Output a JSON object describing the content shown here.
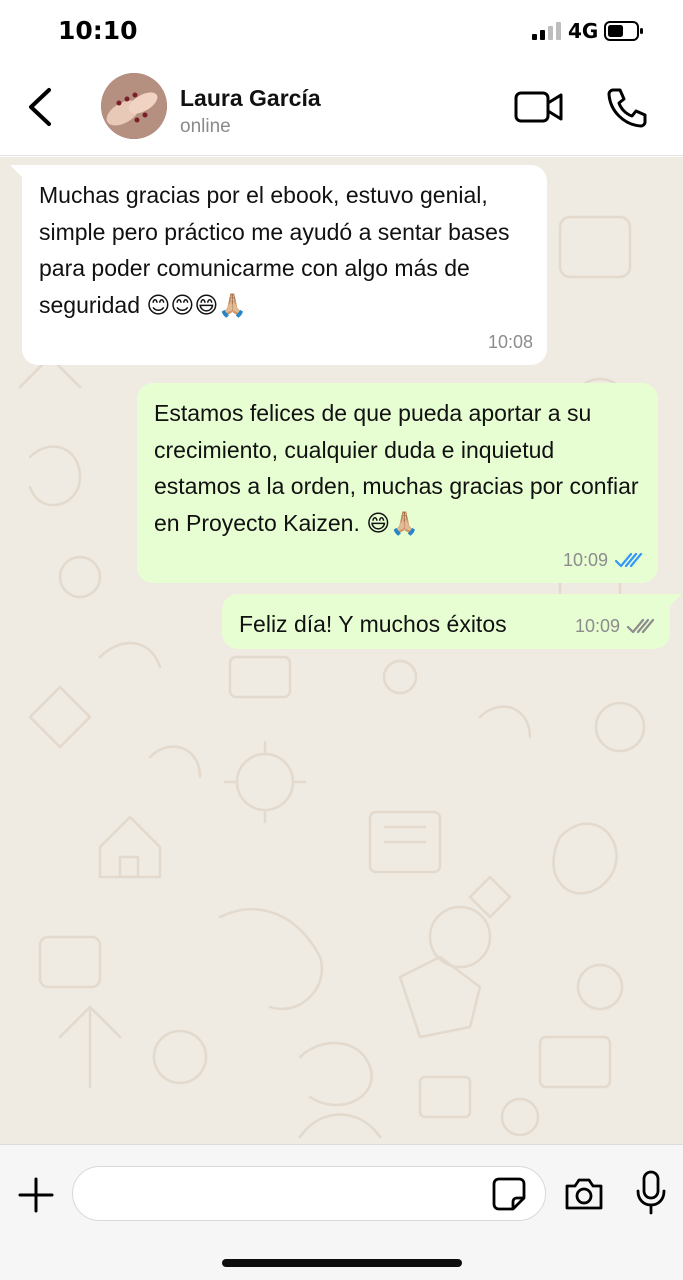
{
  "status_bar": {
    "time": "10:10",
    "network": "4G"
  },
  "header": {
    "contact_name": "Laura García",
    "contact_status": "online"
  },
  "messages": [
    {
      "direction": "incoming",
      "text": "Muchas gracias por el ebook, estuvo genial, simple pero práctico me ayudó a sentar bases para poder comunicarme con algo más de seguridad 😊😊😄🙏🏼",
      "time": "10:08"
    },
    {
      "direction": "outgoing",
      "text": "Estamos felices de que pueda aportar a su crecimiento, cualquier duda e inquietud estamos a la orden, muchas gracias por confiar en Proyecto Kaizen. 😄🙏🏼",
      "time": "10:09",
      "status": "read"
    },
    {
      "direction": "outgoing",
      "text": "Feliz día! Y muchos éxitos",
      "time": "10:09",
      "status": "delivered"
    }
  ],
  "input": {
    "value": "",
    "placeholder": ""
  },
  "colors": {
    "chat_background": "#efeae2",
    "incoming_bubble": "#ffffff",
    "outgoing_bubble": "#e7fed3",
    "read_tick": "#3497f9",
    "delivered_tick": "#8c8c8c"
  },
  "icons": {
    "back": "chevron-left-icon",
    "video": "video-camera-icon",
    "call": "phone-icon",
    "add": "plus-icon",
    "sticker": "sticker-icon",
    "camera": "camera-icon",
    "mic": "microphone-icon"
  }
}
